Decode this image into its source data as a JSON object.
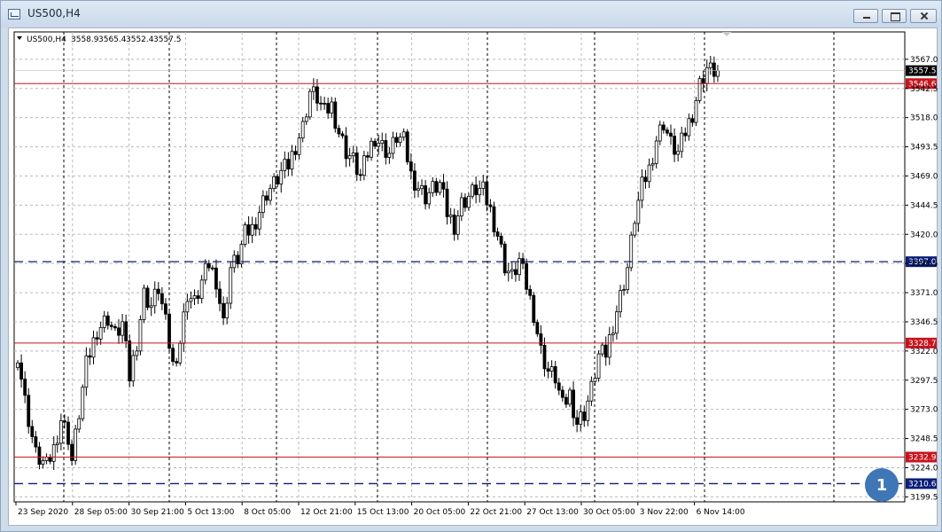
{
  "window": {
    "title": "US500,H4",
    "buttons": {
      "minimize": "minimize",
      "maximize": "maximize",
      "close": "close"
    }
  },
  "chart_info": {
    "symbol": "US500,H4",
    "open": "3558.9",
    "high": "3565.4",
    "low": "3552.4",
    "close": "3557.5"
  },
  "chart_data": {
    "type": "candlestick",
    "y_range": [
      3195.3,
      3590.0
    ],
    "y_ticks": [
      "3567.0",
      "3542.5",
      "3518.0",
      "3493.5",
      "3469.0",
      "3444.5",
      "3420.0",
      "3395.5",
      "3371.0",
      "3346.5",
      "3322.0",
      "3297.5",
      "3273.0",
      "3248.5",
      "3224.0",
      "3199.5"
    ],
    "x_labels": [
      "23 Sep 2020",
      "28 Sep 05:00",
      "30 Sep 21:00",
      "5 Oct 13:00",
      "8 Oct 05:00",
      "12 Oct 21:00",
      "15 Oct 13:00",
      "20 Oct 05:00",
      "22 Oct 21:00",
      "27 Oct 13:00",
      "30 Oct 05:00",
      "3 Nov 22:00",
      "6 Nov 14:00"
    ],
    "current_price": "3557.5",
    "levels": [
      {
        "value": 3546.6,
        "label": "3546.6",
        "style": "solid",
        "color": "#c8141e"
      },
      {
        "value": 3397.0,
        "label": "3397.0",
        "style": "dashed",
        "color": "#0a1e78"
      },
      {
        "value": 3328.7,
        "label": "3328.7",
        "style": "solid",
        "color": "#c8141e"
      },
      {
        "value": 3232.9,
        "label": "3232.9",
        "style": "solid",
        "color": "#c8141e"
      },
      {
        "value": 3210.6,
        "label": "3210.6",
        "style": "dashed",
        "color": "#0a1e78"
      }
    ],
    "close_path": [
      [
        0,
        3320
      ],
      [
        2,
        3280
      ],
      [
        5,
        3235
      ],
      [
        8,
        3225
      ],
      [
        10,
        3240
      ],
      [
        12,
        3265
      ],
      [
        14,
        3250
      ],
      [
        15,
        3230
      ],
      [
        17,
        3270
      ],
      [
        19,
        3310
      ],
      [
        22,
        3340
      ],
      [
        25,
        3350
      ],
      [
        27,
        3335
      ],
      [
        29,
        3345
      ],
      [
        31,
        3300
      ],
      [
        33,
        3330
      ],
      [
        35,
        3370
      ],
      [
        37,
        3360
      ],
      [
        39,
        3375
      ],
      [
        41,
        3345
      ],
      [
        43,
        3310
      ],
      [
        45,
        3330
      ],
      [
        47,
        3370
      ],
      [
        49,
        3362
      ],
      [
        51,
        3380
      ],
      [
        53,
        3395
      ],
      [
        55,
        3382
      ],
      [
        57,
        3345
      ],
      [
        59,
        3392
      ],
      [
        61,
        3400
      ],
      [
        63,
        3420
      ],
      [
        65,
        3425
      ],
      [
        67,
        3440
      ],
      [
        69,
        3455
      ],
      [
        71,
        3462
      ],
      [
        73,
        3472
      ],
      [
        75,
        3478
      ],
      [
        77,
        3495
      ],
      [
        79,
        3510
      ],
      [
        81,
        3540
      ],
      [
        83,
        3535
      ],
      [
        85,
        3522
      ],
      [
        87,
        3528
      ],
      [
        89,
        3506
      ],
      [
        91,
        3490
      ],
      [
        93,
        3482
      ],
      [
        95,
        3468
      ],
      [
        97,
        3488
      ],
      [
        99,
        3502
      ],
      [
        101,
        3494
      ],
      [
        103,
        3488
      ],
      [
        105,
        3502
      ],
      [
        107,
        3498
      ],
      [
        109,
        3470
      ],
      [
        111,
        3460
      ],
      [
        113,
        3452
      ],
      [
        115,
        3458
      ],
      [
        117,
        3462
      ],
      [
        119,
        3438
      ],
      [
        121,
        3428
      ],
      [
        123,
        3446
      ],
      [
        125,
        3452
      ],
      [
        127,
        3458
      ],
      [
        129,
        3456
      ],
      [
        131,
        3440
      ],
      [
        133,
        3420
      ],
      [
        135,
        3394
      ],
      [
        137,
        3384
      ],
      [
        139,
        3398
      ],
      [
        141,
        3377
      ],
      [
        143,
        3354
      ],
      [
        145,
        3322
      ],
      [
        147,
        3305
      ],
      [
        149,
        3300
      ],
      [
        151,
        3275
      ],
      [
        153,
        3286
      ],
      [
        155,
        3262
      ],
      [
        157,
        3270
      ],
      [
        159,
        3290
      ],
      [
        161,
        3318
      ],
      [
        163,
        3320
      ],
      [
        165,
        3345
      ],
      [
        167,
        3368
      ],
      [
        169,
        3392
      ],
      [
        171,
        3434
      ],
      [
        173,
        3460
      ],
      [
        175,
        3475
      ],
      [
        177,
        3500
      ],
      [
        179,
        3514
      ],
      [
        181,
        3496
      ],
      [
        183,
        3488
      ],
      [
        185,
        3506
      ],
      [
        187,
        3522
      ],
      [
        189,
        3546
      ],
      [
        191,
        3560
      ],
      [
        192,
        3557.5
      ]
    ]
  },
  "marker": {
    "label": "1"
  }
}
